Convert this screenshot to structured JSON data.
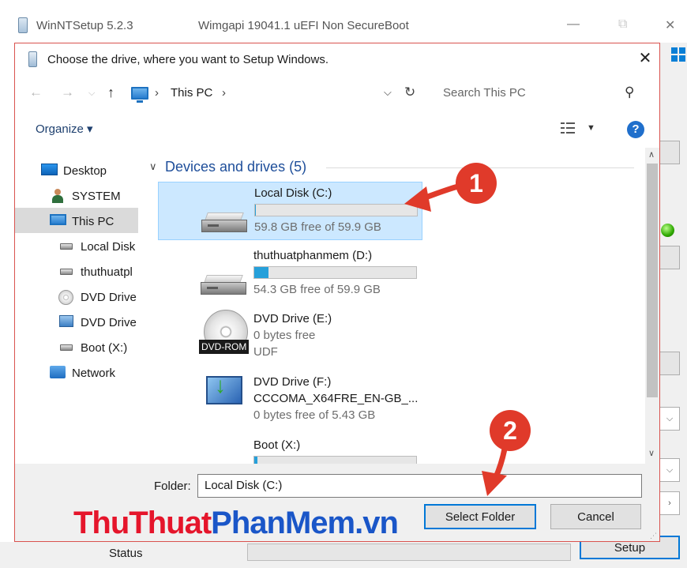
{
  "background_window": {
    "title": "WinNTSetup 5.2.3",
    "subtitle": "Wimgapi 19041.1   uEFI Non SecureBoot",
    "status_label": "Status",
    "setup_button": "Setup"
  },
  "dialog": {
    "title": "Choose the drive, where you want to Setup Windows.",
    "close_glyph": "✕",
    "breadcrumb": [
      "This PC"
    ],
    "search_placeholder": "Search This PC",
    "organize_label": "Organize ▾",
    "nav_pane": [
      {
        "label": "Desktop",
        "icon": "desktop-icon"
      },
      {
        "label": "SYSTEM",
        "icon": "user-icon"
      },
      {
        "label": "This PC",
        "icon": "computer-icon",
        "selected": true
      },
      {
        "label": "Local Disk",
        "icon": "hard-drive-icon"
      },
      {
        "label": "thuthuatpl",
        "icon": "hard-drive-icon"
      },
      {
        "label": "DVD Drive",
        "icon": "dvd-disc-icon"
      },
      {
        "label": "DVD Drive",
        "icon": "dvd-install-icon"
      },
      {
        "label": "Boot (X:)",
        "icon": "hard-drive-icon"
      },
      {
        "label": "Network",
        "icon": "network-icon"
      }
    ],
    "group_header": "Devices and drives (5)",
    "drives": [
      {
        "name": "Local Disk (C:)",
        "detail": "59.8 GB free of 59.9 GB",
        "used_fraction": 0.002,
        "selected": true
      },
      {
        "name": "thuthuatphanmem (D:)",
        "detail": "54.3 GB free of 59.9 GB",
        "used_fraction": 0.09
      },
      {
        "name": "DVD Drive (E:)",
        "detail": "0 bytes free",
        "detail2": "UDF",
        "badge": "DVD-ROM"
      },
      {
        "name": "DVD Drive (F:)",
        "name2": "CCCOMA_X64FRE_EN-GB_...",
        "detail": "0 bytes free of 5.43 GB"
      },
      {
        "name": "Boot (X:)",
        "used_fraction": 0.02
      }
    ],
    "folder_label": "Folder:",
    "folder_value": "Local Disk (C:)",
    "select_button": "Select Folder",
    "cancel_button": "Cancel"
  },
  "annotations": {
    "marker_1": "1",
    "marker_2": "2",
    "color": "#e03a2a"
  },
  "watermark": {
    "part_a": "ThuThuat",
    "part_b": "PhanMem",
    "part_c": ".vn"
  }
}
